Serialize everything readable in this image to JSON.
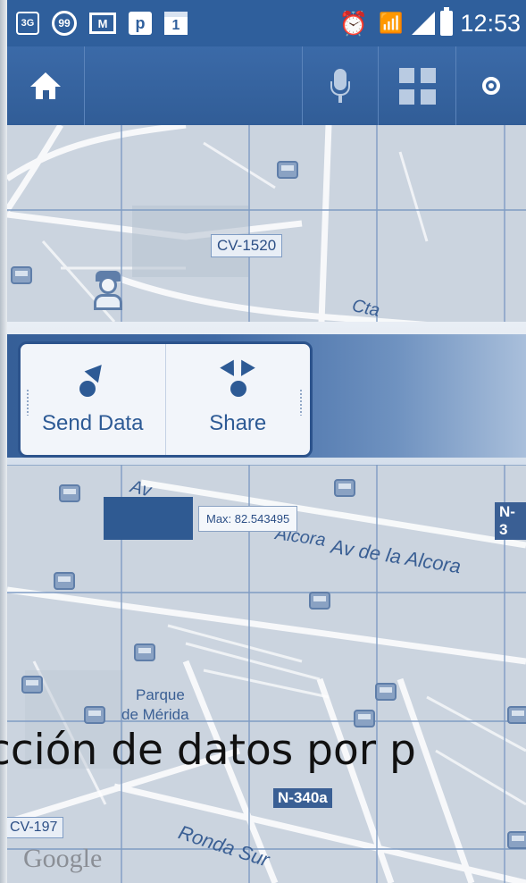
{
  "status_bar": {
    "notification_icons": [
      "3G",
      "99",
      "M",
      "p",
      "1"
    ],
    "time": "12:53"
  },
  "toolbar": {
    "icons": [
      "home-icon",
      "microphone-icon",
      "grid-icon",
      "location-icon"
    ]
  },
  "map": {
    "labels": {
      "cv1520": "CV-1520",
      "cta": "Cta",
      "av_partial": "Av",
      "alcora_partial": "Alcora",
      "av_de_la_alcora": "Av de la Alcora",
      "n3_partial": "N-3",
      "parque": "Parque",
      "de_merida": "de Mérida",
      "n340a": "N-340a",
      "cv197": "CV-197",
      "ronda_sur": "Ronda Sur",
      "google": "Google"
    }
  },
  "actions": {
    "send_data": "Send Data",
    "share": "Share"
  },
  "marker": {
    "tooltip": "Max: 82.543495"
  },
  "caption": "cción de datos por p",
  "colors": {
    "brand_blue": "#2f5f9c",
    "map_background": "#c9d2dd",
    "grid_line": "#7f9cc4"
  }
}
